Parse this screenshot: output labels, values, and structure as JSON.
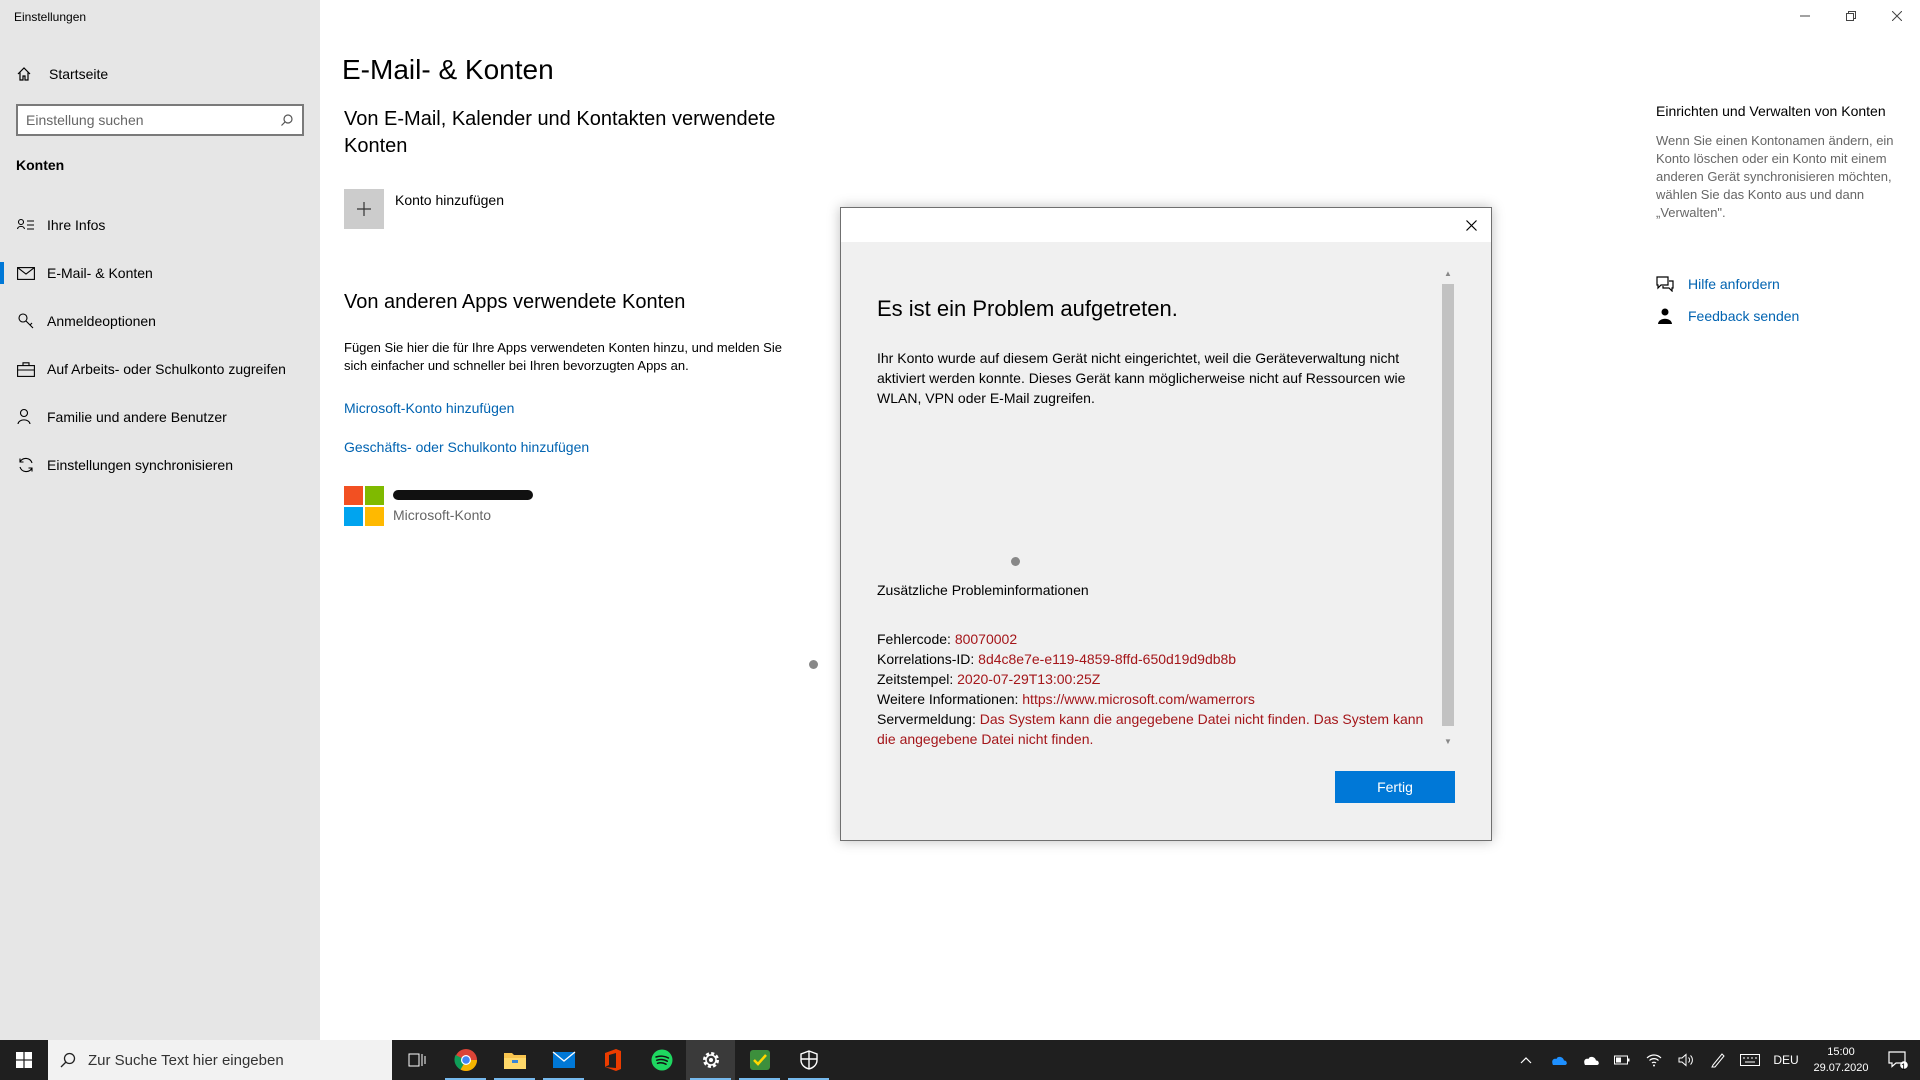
{
  "window": {
    "title": "Einstellungen"
  },
  "sidebar": {
    "home_label": "Startseite",
    "search_placeholder": "Einstellung suchen",
    "section_label": "Konten",
    "items": [
      {
        "label": "Ihre Infos",
        "icon": "person-card-icon"
      },
      {
        "label": "E-Mail- & Konten",
        "icon": "mail-icon",
        "active": true
      },
      {
        "label": "Anmeldeoptionen",
        "icon": "key-icon"
      },
      {
        "label": "Auf Arbeits- oder Schulkonto zugreifen",
        "icon": "briefcase-icon"
      },
      {
        "label": "Familie und andere Benutzer",
        "icon": "person-add-icon"
      },
      {
        "label": "Einstellungen synchronisieren",
        "icon": "sync-icon"
      }
    ]
  },
  "main": {
    "title": "E-Mail- & Konten",
    "subtitle": "Von E-Mail, Kalender und Kontakten verwendete Konten",
    "add_account_label": "Konto hinzufügen",
    "other_apps_heading": "Von anderen Apps verwendete Konten",
    "other_apps_desc": "Fügen Sie hier die für Ihre Apps verwendeten Konten hinzu, und melden Sie sich einfacher und schneller bei Ihren bevorzugten Apps an.",
    "link_microsoft": "Microsoft-Konto hinzufügen",
    "link_work": "Geschäfts- oder Schulkonto hinzufügen",
    "account": {
      "type": "Microsoft-Konto"
    }
  },
  "right_panel": {
    "title": "Einrichten und Verwalten von Konten",
    "text": "Wenn Sie einen Kontonamen ändern, ein Konto löschen oder ein Konto mit einem anderen Gerät synchronisieren möchten, wählen Sie das Konto aus und dann „Verwalten\".",
    "help_link": "Hilfe anfordern",
    "feedback_link": "Feedback senden"
  },
  "dialog": {
    "heading": "Es ist ein Problem aufgetreten.",
    "body": "Ihr Konto wurde auf diesem Gerät nicht eingerichtet, weil die Geräteverwaltung nicht aktiviert werden konnte. Dieses Gerät kann möglicherweise nicht auf Ressourcen wie WLAN, VPN oder E-Mail zugreifen.",
    "info_heading": "Zusätzliche Probleminformationen",
    "error_code_label": "Fehlercode:",
    "error_code": "80070002",
    "correlation_label": "Korrelations-ID:",
    "correlation_id": "8d4c8e7e-e119-4859-8ffd-650d19d9db8b",
    "timestamp_label": "Zeitstempel:",
    "timestamp": "2020-07-29T13:00:25Z",
    "more_info_label": "Weitere Informationen:",
    "more_info_url": "https://www.microsoft.com/wamerrors",
    "server_msg_label": "Servermeldung:",
    "server_msg": "Das System kann die angegebene Datei nicht finden. Das System kann die angegebene Datei nicht finden.",
    "done_button": "Fertig"
  },
  "taskbar": {
    "search_placeholder": "Zur Suche Text hier eingeben",
    "apps": [
      "task-view-icon",
      "chrome-icon",
      "file-explorer-icon",
      "mail-app-icon",
      "office-icon",
      "spotify-icon",
      "settings-gear-icon",
      "shield-check-app-icon",
      "security-shield-icon"
    ],
    "language": "DEU",
    "time": "15:00",
    "date": "29.07.2020",
    "notification_count": "1"
  },
  "colors": {
    "accent": "#0078d7",
    "link": "#0063b1",
    "error_value": "#a4161a",
    "sidebar_bg": "#e6e6e6",
    "taskbar_bg": "#1f1f1f"
  }
}
